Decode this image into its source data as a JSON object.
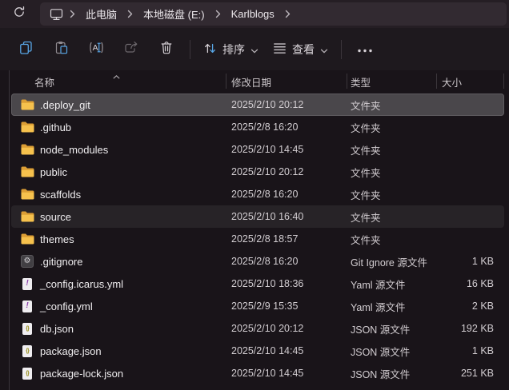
{
  "breadcrumb": {
    "items": [
      "此电脑",
      "本地磁盘 (E:)",
      "Karlblogs"
    ]
  },
  "toolbar": {
    "sort_label": "排序",
    "view_label": "查看"
  },
  "columns": [
    {
      "label": "名称",
      "sorted": "asc"
    },
    {
      "label": "修改日期"
    },
    {
      "label": "类型"
    },
    {
      "label": "大小"
    }
  ],
  "glyphs": {
    "gear": "⚙",
    "yaml_mark": "!",
    "json_mark": "{}"
  },
  "icons": {
    "refresh": "refresh-icon",
    "this_pc": "monitor-icon",
    "copy": "copy-icon",
    "paste": "paste-icon",
    "rename": "rename-icon",
    "share": "share-icon",
    "delete": "trash-icon",
    "sort": "sort-arrows-icon",
    "view": "list-lines-icon",
    "more": "more-options-icon"
  },
  "colors": {
    "accent_blue": "#58a6e6",
    "folder_front": "#f6c14d",
    "folder_back": "#dc9e35",
    "selected_row_bg": "#4a474b",
    "hovered_row_bg": "#272327",
    "topbar_bg": "#251e24",
    "toolbar_bg": "#1e191e",
    "list_bg": "#191419"
  },
  "files": [
    {
      "name": ".deploy_git",
      "date": "2025/2/10 20:12",
      "type": "文件夹",
      "size": "",
      "icon": "folder-icon",
      "state": "selected"
    },
    {
      "name": ".github",
      "date": "2025/2/8 16:20",
      "type": "文件夹",
      "size": "",
      "icon": "folder-icon",
      "state": ""
    },
    {
      "name": "node_modules",
      "date": "2025/2/10 14:45",
      "type": "文件夹",
      "size": "",
      "icon": "folder-icon",
      "state": ""
    },
    {
      "name": "public",
      "date": "2025/2/10 20:12",
      "type": "文件夹",
      "size": "",
      "icon": "folder-icon",
      "state": ""
    },
    {
      "name": "scaffolds",
      "date": "2025/2/8 16:20",
      "type": "文件夹",
      "size": "",
      "icon": "folder-icon",
      "state": ""
    },
    {
      "name": "source",
      "date": "2025/2/10 16:40",
      "type": "文件夹",
      "size": "",
      "icon": "folder-icon",
      "state": "hovered"
    },
    {
      "name": "themes",
      "date": "2025/2/8 18:57",
      "type": "文件夹",
      "size": "",
      "icon": "folder-icon",
      "state": ""
    },
    {
      "name": ".gitignore",
      "date": "2025/2/8 16:20",
      "type": "Git Ignore 源文件",
      "size": "1 KB",
      "icon": "gitignore-gear-icon",
      "state": ""
    },
    {
      "name": "_config.icarus.yml",
      "date": "2025/2/10 18:36",
      "type": "Yaml 源文件",
      "size": "16 KB",
      "icon": "yaml-file-icon",
      "state": ""
    },
    {
      "name": "_config.yml",
      "date": "2025/2/9 15:35",
      "type": "Yaml 源文件",
      "size": "2 KB",
      "icon": "yaml-file-icon",
      "state": ""
    },
    {
      "name": "db.json",
      "date": "2025/2/10 20:12",
      "type": "JSON 源文件",
      "size": "192 KB",
      "icon": "json-file-icon",
      "state": ""
    },
    {
      "name": "package.json",
      "date": "2025/2/10 14:45",
      "type": "JSON 源文件",
      "size": "1 KB",
      "icon": "json-file-icon",
      "state": ""
    },
    {
      "name": "package-lock.json",
      "date": "2025/2/10 14:45",
      "type": "JSON 源文件",
      "size": "251 KB",
      "icon": "json-file-icon",
      "state": ""
    }
  ]
}
